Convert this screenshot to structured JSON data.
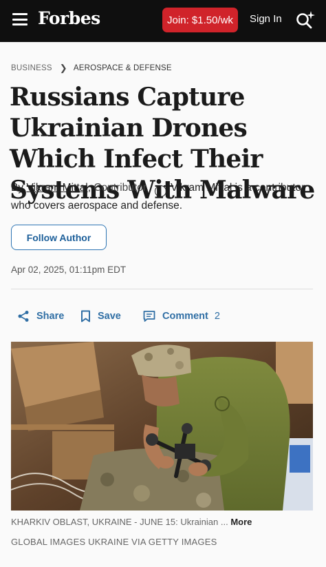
{
  "header": {
    "logo": "Forbes",
    "join_label": "Join: $1.50/wk",
    "signin_label": "Sign In"
  },
  "breadcrumb": {
    "section": "BUSINESS",
    "subsection": "AEROSPACE & DEFENSE"
  },
  "article": {
    "title": "Russians Capture Ukrainian Drones Which Infect Their Systems With Malware",
    "byline_prefix": "By",
    "author": "Vikram Mittal",
    "role": "Contributor.",
    "author_bio": "Vikram Mittal is a contributor who covers aerospace and defense.",
    "follow_label": "Follow Author",
    "date": "Apr 02, 2025, 01:11pm EDT"
  },
  "actions": {
    "share_label": "Share",
    "save_label": "Save",
    "comment_label": "Comment",
    "comment_count": "2"
  },
  "image": {
    "caption": "KHARKIV OBLAST, UKRAINE - JUNE 15: Ukrainian ...",
    "more_label": "More",
    "credit": "GLOBAL IMAGES UKRAINE VIA GETTY IMAGES"
  },
  "colors": {
    "header_bg": "#0f0f0f",
    "join_red": "#d0232a",
    "link_blue": "#2f6ea4"
  }
}
